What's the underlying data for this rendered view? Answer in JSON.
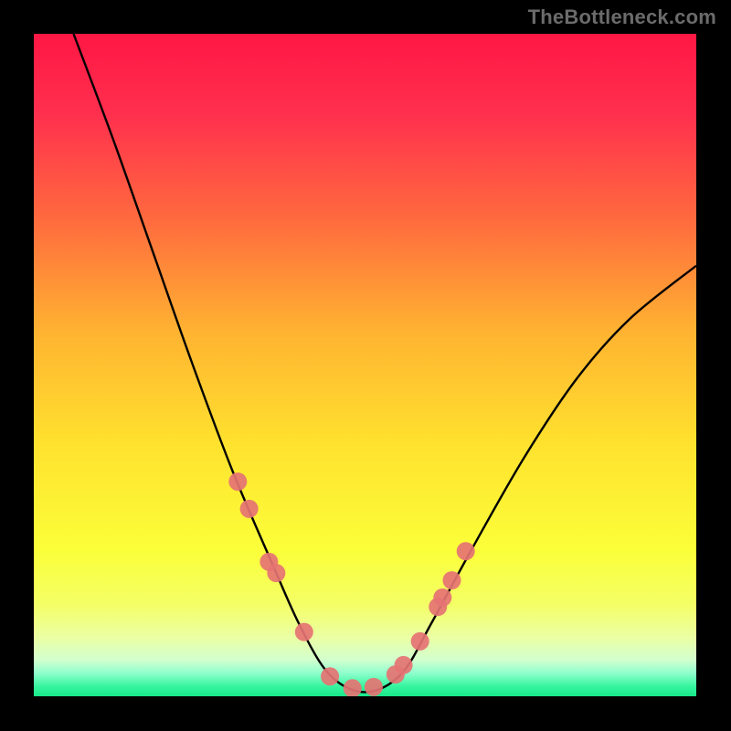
{
  "watermark": "TheBottleneck.com",
  "chart_data": {
    "type": "line",
    "title": "",
    "xlabel": "",
    "ylabel": "",
    "xlim": [
      0,
      100
    ],
    "ylim": [
      0,
      100
    ],
    "grid": false,
    "legend": false,
    "series": [
      {
        "name": "bottleneck-curve",
        "x": [
          6,
          12,
          18,
          24,
          30,
          36,
          40,
          44,
          48,
          52,
          56,
          60,
          66,
          74,
          82,
          90,
          100
        ],
        "y": [
          100,
          84,
          67,
          50,
          34,
          20,
          11,
          4,
          1,
          1,
          4,
          11,
          22,
          36,
          48,
          57,
          65
        ]
      }
    ],
    "markers": {
      "name": "highlight-points",
      "x": [
        30.8,
        32.5,
        35.5,
        36.6,
        40.8,
        44.7,
        48.1,
        51.3,
        54.6,
        55.8,
        58.3,
        61.0,
        61.7,
        63.1,
        65.2
      ],
      "y": [
        32.4,
        28.3,
        20.3,
        18.6,
        9.7,
        3.0,
        1.2,
        1.4,
        3.3,
        4.7,
        8.3,
        13.5,
        14.9,
        17.5,
        21.9
      ]
    },
    "gradient_stops": [
      {
        "offset": 0.0,
        "color": "#ff1744"
      },
      {
        "offset": 0.12,
        "color": "#ff2f4e"
      },
      {
        "offset": 0.28,
        "color": "#ff6a3e"
      },
      {
        "offset": 0.45,
        "color": "#ffb331"
      },
      {
        "offset": 0.62,
        "color": "#ffe22e"
      },
      {
        "offset": 0.78,
        "color": "#fbff39"
      },
      {
        "offset": 0.86,
        "color": "#f4ff65"
      },
      {
        "offset": 0.91,
        "color": "#ecffa2"
      },
      {
        "offset": 0.945,
        "color": "#d3ffce"
      },
      {
        "offset": 0.965,
        "color": "#8fffcd"
      },
      {
        "offset": 0.985,
        "color": "#36f59e"
      },
      {
        "offset": 1.0,
        "color": "#17e889"
      }
    ],
    "marker_color": "#e57373",
    "curve_color": "#000000"
  }
}
